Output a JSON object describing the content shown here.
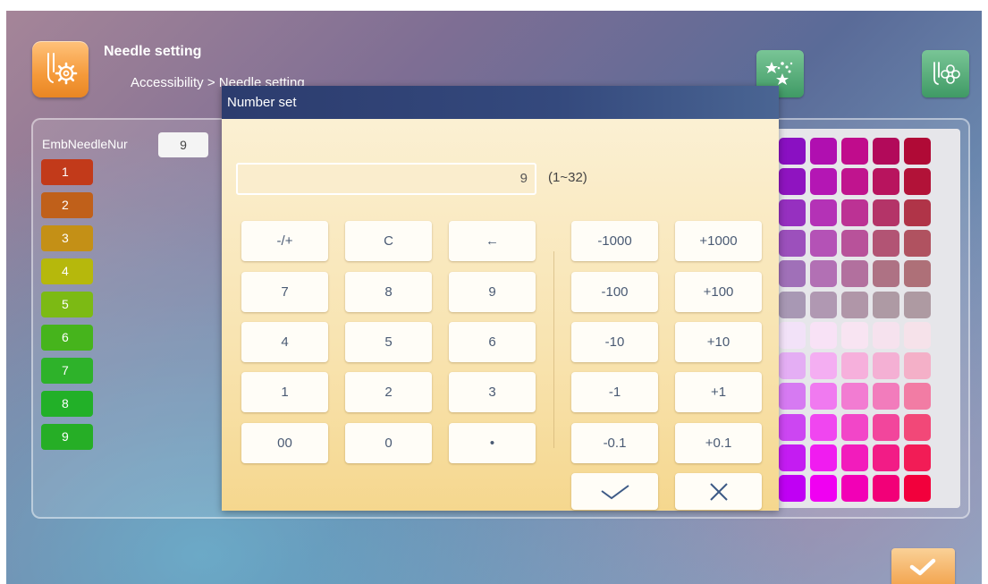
{
  "header": {
    "title": "Needle setting",
    "breadcrumb": "Accessibility > Needle setting"
  },
  "panel": {
    "emb_label": "EmbNeedleNur",
    "emb_value": "9",
    "needles": [
      {
        "label": "1",
        "color": "#c23a1a"
      },
      {
        "label": "2",
        "color": "#c0601a"
      },
      {
        "label": "3",
        "color": "#c49016"
      },
      {
        "label": "4",
        "color": "#b6b80c"
      },
      {
        "label": "5",
        "color": "#7cba14"
      },
      {
        "label": "6",
        "color": "#46b41c"
      },
      {
        "label": "7",
        "color": "#2eb22a"
      },
      {
        "label": "8",
        "color": "#22b028"
      },
      {
        "label": "9",
        "color": "#26ae26"
      }
    ],
    "color_grid": [
      [
        "#8a10c2",
        "#b00fb0",
        "#c00c8c",
        "#b20a5a",
        "#b00a36"
      ],
      [
        "#8f14c0",
        "#b416b4",
        "#c0148e",
        "#b8145e",
        "#b21238"
      ],
      [
        "#9630c0",
        "#b432b6",
        "#bc3294",
        "#b43468",
        "#b03448"
      ],
      [
        "#9c50bc",
        "#b452b6",
        "#b8529a",
        "#b25474",
        "#b05260"
      ],
      [
        "#a070b8",
        "#b270b4",
        "#b2709e",
        "#ae7284",
        "#ae7078"
      ],
      [
        "#a898b4",
        "#b098b2",
        "#b096a8",
        "#ae9aa4",
        "#ae9aa2"
      ],
      [
        "#f2e2f8",
        "#f8e2f6",
        "#f8e4f2",
        "#f6e2ee",
        "#f6e2ea"
      ],
      [
        "#e4aef4",
        "#f4aef2",
        "#f6b0dc",
        "#f4b0d4",
        "#f4b0c8"
      ],
      [
        "#d67af2",
        "#f07af0",
        "#f27cd2",
        "#f27cbc",
        "#f27ca4"
      ],
      [
        "#cc46f2",
        "#f046f0",
        "#f246c8",
        "#f2469c",
        "#f24878"
      ],
      [
        "#c41cf2",
        "#f01cf0",
        "#f21cbc",
        "#f21c86",
        "#f21c56"
      ],
      [
        "#c000f4",
        "#f000f2",
        "#f200b6",
        "#f20078",
        "#f2003c"
      ]
    ]
  },
  "dialog": {
    "title": "Number set",
    "input_value": "9",
    "range": "(1~32)",
    "keypad": [
      "-/+",
      "C",
      "←",
      "7",
      "8",
      "9",
      "4",
      "5",
      "6",
      "1",
      "2",
      "3",
      "00",
      "0",
      "•"
    ],
    "steps": [
      "-1000",
      "+1000",
      "-100",
      "+100",
      "-10",
      "+10",
      "-1",
      "+1",
      "-0.1",
      "+0.1"
    ]
  },
  "icons": {
    "header": "needle-gear-icon",
    "top_left": "sparkle-stars-icon",
    "top_right": "needle-flower-icon",
    "confirm": "checkmark-icon",
    "cancel": "close-icon"
  }
}
